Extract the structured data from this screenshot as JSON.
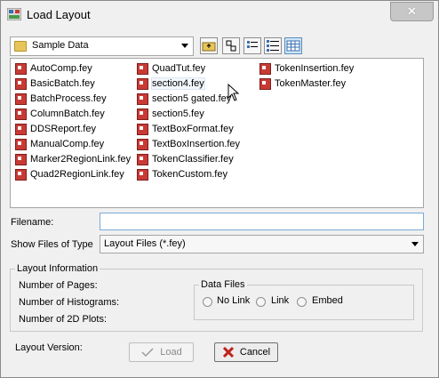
{
  "window": {
    "title": "Load Layout",
    "close_label": "✕"
  },
  "location": {
    "value": "Sample Data"
  },
  "files": [
    "AutoComp.fey",
    "BasicBatch.fey",
    "BatchProcess.fey",
    "ColumnBatch.fey",
    "DDSReport.fey",
    "ManualComp.fey",
    "Marker2RegionLink.fey",
    "Quad2RegionLink.fey",
    "QuadTut.fey",
    "section4.fey",
    "section5 gated.fey",
    "section5.fey",
    "TextBoxFormat.fey",
    "TextBoxInsertion.fey",
    "TokenClassifier.fey",
    "TokenCustom.fey",
    "TokenInsertion.fey",
    "TokenMaster.fey"
  ],
  "filename": {
    "label": "Filename:",
    "value": ""
  },
  "filetype": {
    "label": "Show Files of Type",
    "value": "Layout Files (*.fey)"
  },
  "layout_info": {
    "title": "Layout Information",
    "pages_label": "Number of Pages:",
    "histograms_label": "Number of Histograms:",
    "plots_label": "Number of 2D Plots:"
  },
  "data_files": {
    "title": "Data Files",
    "options": [
      "No Link",
      "Link",
      "Embed"
    ]
  },
  "version_label": "Layout Version:",
  "buttons": {
    "load": "Load",
    "cancel": "Cancel"
  },
  "colors": {
    "accent_border": "#7aaad6",
    "file_icon": "#c83a35",
    "cancel_x": "#c0201a",
    "load_check": "#9a9a9a"
  }
}
